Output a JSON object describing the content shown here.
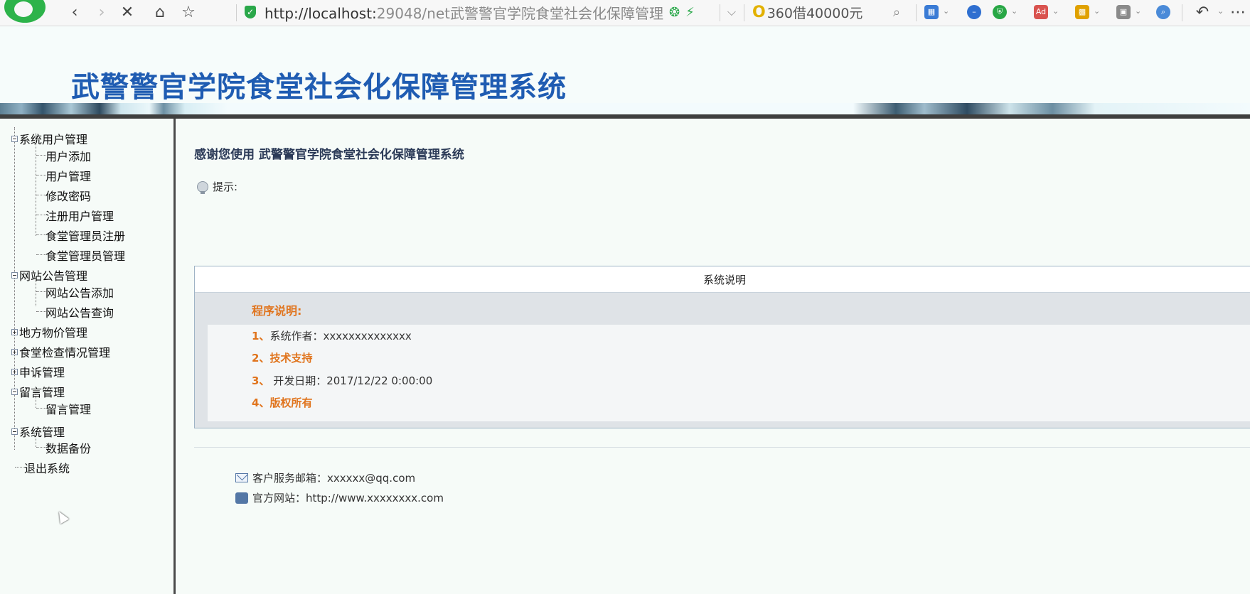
{
  "browser": {
    "url_host": "http://localhost:",
    "url_rest": "29048/net武警警官学院食堂社会化保障管理",
    "search_text": "360借40000元"
  },
  "site": {
    "title": "武警警官学院食堂社会化保障管理系统"
  },
  "sidebar": {
    "groups": [
      {
        "label": "系统用户管理",
        "expanded": true,
        "items": [
          "用户添加",
          "用户管理",
          "修改密码",
          "注册用户管理",
          "食堂管理员注册",
          "食堂管理员管理"
        ]
      },
      {
        "label": "网站公告管理",
        "expanded": true,
        "items": [
          "网站公告添加",
          "网站公告查询"
        ]
      },
      {
        "label": "地方物价管理",
        "expanded": false,
        "items": []
      },
      {
        "label": "食堂检查情况管理",
        "expanded": false,
        "items": []
      },
      {
        "label": "申诉管理",
        "expanded": false,
        "items": []
      },
      {
        "label": "留言管理",
        "expanded": true,
        "items": [
          "留言管理"
        ]
      },
      {
        "label": "系统管理",
        "expanded": true,
        "items": [
          "数据备份"
        ]
      }
    ],
    "logout": "退出系统"
  },
  "main": {
    "welcome": "感谢您使用 武警警官学院食堂社会化保障管理系统",
    "tip": "提示:",
    "panel_title": "系统说明",
    "program_title": "程序说明:",
    "items": [
      {
        "num": "1、",
        "text": "系统作者：xxxxxxxxxxxxxx"
      },
      {
        "num": "2、",
        "text": "技术支持"
      },
      {
        "num": "3、",
        "text": " 开发日期：2017/12/22 0:00:00"
      },
      {
        "num": "4、",
        "text": "版权所有"
      }
    ],
    "email": "客户服务邮箱：xxxxxx@qq.com",
    "website": "官方网站：http://www.xxxxxxxx.com"
  }
}
